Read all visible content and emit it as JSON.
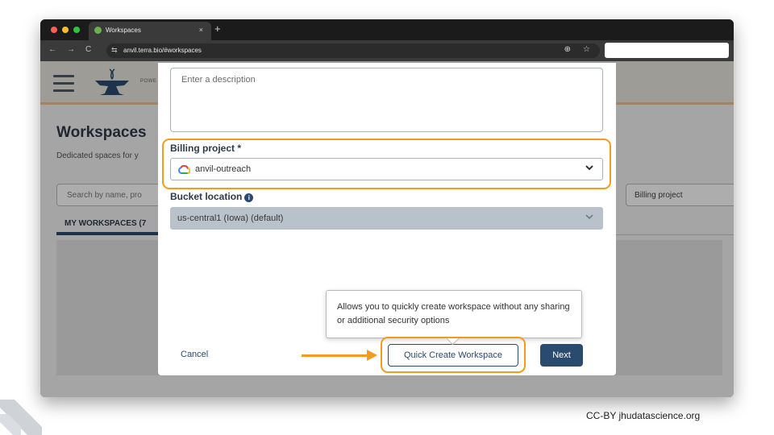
{
  "browser": {
    "tab_title": "Workspaces",
    "tab_close": "×",
    "new_tab": "+",
    "url": "anvil.terra.bio/#workspaces",
    "nav": {
      "back": "←",
      "forward": "→",
      "reload": "C",
      "tune": "⇆"
    },
    "zoom_icon": "⊕",
    "star_icon": "☆"
  },
  "page": {
    "powered_label": "POWE",
    "title": "Workspaces",
    "subtitle": "Dedicated spaces for y",
    "search_placeholder": "Search by name, pro",
    "billing_filter": "Billing project",
    "tab_my_workspaces": "MY WORKSPACES (7"
  },
  "modal": {
    "description_placeholder": "Enter a description",
    "billing_label": "Billing project *",
    "billing_value": "anvil-outreach",
    "bucket_label": "Bucket location",
    "bucket_value": "us-central1 (Iowa) (default)",
    "cancel": "Cancel",
    "quick_create": "Quick Create Workspace",
    "next": "Next",
    "tooltip": "Allows you to quickly create workspace without any sharing or additional security options"
  },
  "icons": {
    "chevron": "chevron-down-icon",
    "info": "i"
  },
  "footer": {
    "credit": "CC-BY  jhudatascience.org"
  },
  "colors": {
    "highlight": "#f29b1d",
    "primary": "#2b4a6f"
  }
}
